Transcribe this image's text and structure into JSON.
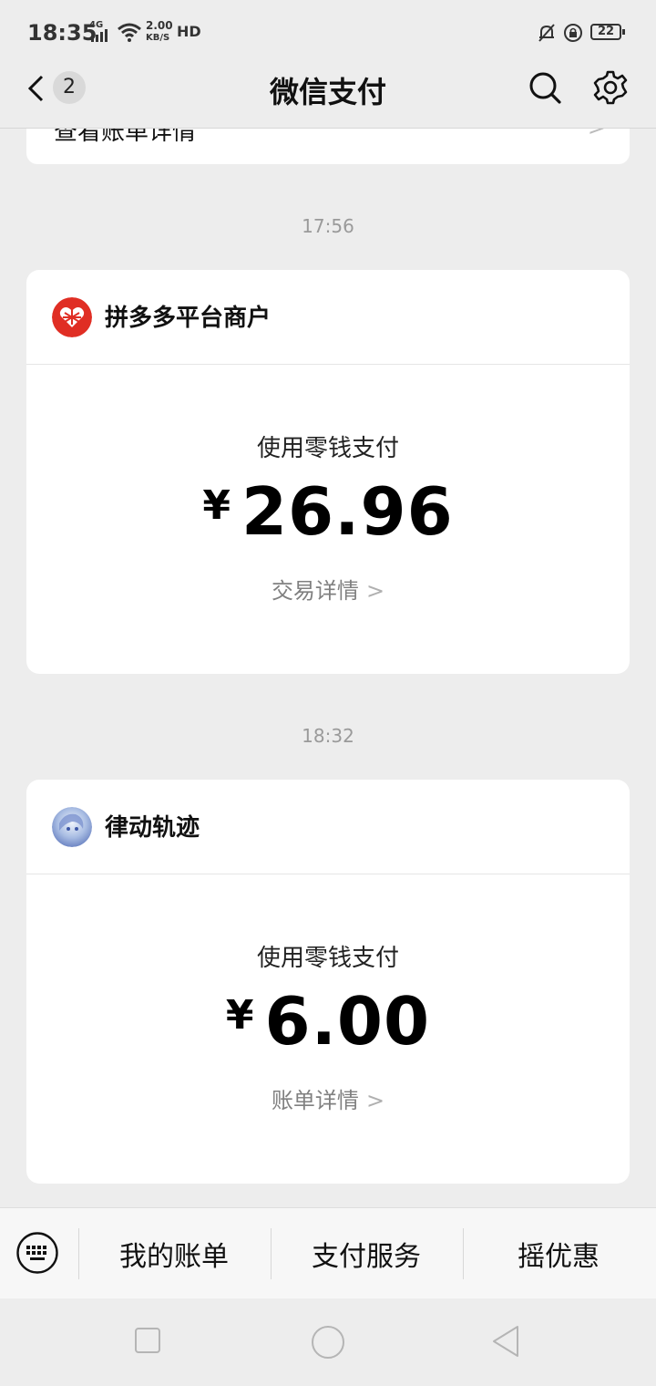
{
  "status_bar": {
    "time": "18:35",
    "network": "4G",
    "speed_value": "2.00",
    "speed_unit": "KB/S",
    "hd": "HD",
    "battery": "22"
  },
  "nav": {
    "badge_count": "2",
    "title": "微信支付"
  },
  "previous_card": {
    "text": "查看账单详情"
  },
  "messages": [
    {
      "time": "17:56",
      "merchant": "拼多多平台商户",
      "pay_method": "使用零钱支付",
      "currency": "¥",
      "amount": "26.96",
      "detail_link": "交易详情"
    },
    {
      "time": "18:32",
      "merchant": "律动轨迹",
      "pay_method": "使用零钱支付",
      "currency": "¥",
      "amount": "6.00",
      "detail_link": "账单详情"
    }
  ],
  "menu": {
    "items": [
      "我的账单",
      "支付服务",
      "摇优惠"
    ]
  },
  "colors": {
    "background": "#ededed",
    "card": "#ffffff",
    "pdd_red": "#e02e24",
    "muted_text": "#808080"
  }
}
